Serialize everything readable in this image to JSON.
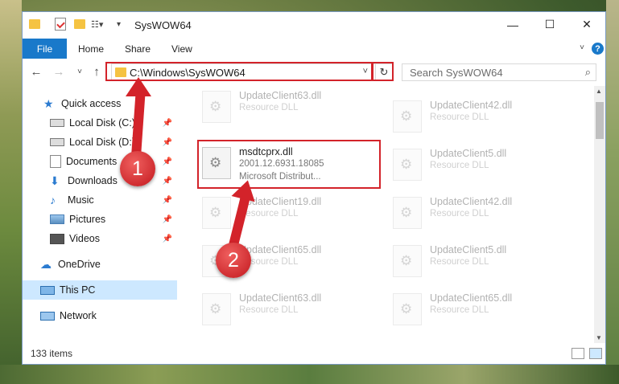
{
  "window": {
    "title": "SysWOW64",
    "minimize": "—",
    "maximize": "☐",
    "close": "✕"
  },
  "ribbon": {
    "tabs": [
      "File",
      "Home",
      "Share",
      "View"
    ]
  },
  "navigation": {
    "back": "←",
    "forward": "→",
    "recent": "˅",
    "up": "↑",
    "address": "C:\\Windows\\SysWOW64",
    "refresh": "↻",
    "search_placeholder": "Search SysWOW64"
  },
  "sidebar": {
    "items": [
      {
        "label": "Quick access",
        "icon": "star-icon"
      },
      {
        "label": "Local Disk (C:)",
        "icon": "drive-icon",
        "pinned": true
      },
      {
        "label": "Local Disk (D:)",
        "icon": "drive-icon",
        "pinned": true
      },
      {
        "label": "Documents",
        "icon": "documents-icon",
        "pinned": true
      },
      {
        "label": "Downloads",
        "icon": "download-icon",
        "pinned": true
      },
      {
        "label": "Music",
        "icon": "music-icon",
        "pinned": true
      },
      {
        "label": "Pictures",
        "icon": "pictures-icon",
        "pinned": true
      },
      {
        "label": "Videos",
        "icon": "videos-icon",
        "pinned": true
      },
      {
        "label": "OneDrive",
        "icon": "cloud-icon"
      },
      {
        "label": "This PC",
        "icon": "computer-icon",
        "selected": true
      },
      {
        "label": "Network",
        "icon": "network-icon"
      }
    ]
  },
  "files": {
    "left": [
      {
        "name": "UpdateClient63.dll",
        "type": "Resource DLL"
      },
      {
        "name": "msdtcprx.dll",
        "version": "2001.12.6931.18085",
        "description": "Microsoft Distribut..."
      },
      {
        "name": "UpdateClient19.dll",
        "type": "Resource DLL"
      },
      {
        "name": "UpdateClient65.dll",
        "type": "Resource DLL"
      },
      {
        "name": "UpdateClient63.dll",
        "type": "Resource DLL"
      }
    ],
    "right": [
      {
        "name": "UpdateClient42.dll",
        "type": "Resource DLL"
      },
      {
        "name": "UpdateClient5.dll",
        "type": "Resource DLL"
      },
      {
        "name": "UpdateClient42.dll",
        "type": "Resource DLL"
      },
      {
        "name": "UpdateClient5.dll",
        "type": "Resource DLL"
      },
      {
        "name": "UpdateClient65.dll",
        "type": "Resource DLL"
      }
    ]
  },
  "status": {
    "item_count": "133 items"
  },
  "annotations": {
    "step1": "1",
    "step2": "2",
    "color": "#d3232a"
  }
}
